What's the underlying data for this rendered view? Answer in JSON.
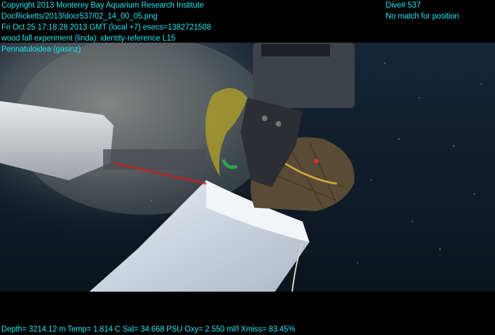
{
  "overlay": {
    "top_left": [
      "Copyright 2013 Monterey Bay Aquarium Research Institute",
      "DocRicketts/2013/docr537/02_14_00_05.png",
      "Fri Oct 25 17:18:28 2013 GMT (local +7)  esecs=1382721508",
      "wood fall experiment (linda): identity-reference L15",
      "Pennatuloidea (gasinz)"
    ],
    "top_right": [
      "Dive# 537",
      "No match for position"
    ],
    "bottom": "Depth= 3214.12 m  Temp= 1.814 C  Sal= 34.668 PSU  Oxy= 2.550 ml/l  Xmiss= 83.45%"
  },
  "colors": {
    "overlay_text": "#1ee6f0",
    "water": "#0e1a26",
    "background": "#000000"
  }
}
